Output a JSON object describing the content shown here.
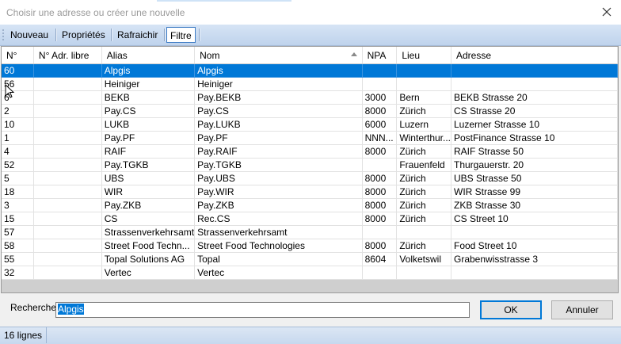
{
  "window": {
    "title": "Choisir une adresse ou créer une nouvelle"
  },
  "toolbar": {
    "items": [
      "Nouveau",
      "Propriétés",
      "Rafraichir",
      "Filtre"
    ]
  },
  "grid": {
    "columns": [
      "N°",
      "N° Adr. libre",
      "Alias",
      "Nom",
      "NPA",
      "Lieu",
      "Adresse"
    ],
    "sort_column": "Nom",
    "rows": [
      [
        "60",
        "",
        "Alpgis",
        "Alpgis",
        "",
        "",
        ""
      ],
      [
        "56",
        "",
        "Heiniger",
        "Heiniger",
        "",
        "",
        ""
      ],
      [
        "6",
        "",
        "BEKB",
        "Pay.BEKB",
        "3000",
        "Bern",
        "BEKB Strasse 20"
      ],
      [
        "2",
        "",
        "Pay.CS",
        "Pay.CS",
        "8000",
        "Zürich",
        "CS Strasse 20"
      ],
      [
        "10",
        "",
        "LUKB",
        "Pay.LUKB",
        "6000",
        "Luzern",
        "Luzerner Strasse 10"
      ],
      [
        "1",
        "",
        "Pay.PF",
        "Pay.PF",
        "NNN...",
        "Winterthur...",
        "PostFinance Strasse 10"
      ],
      [
        "4",
        "",
        "RAIF",
        "Pay.RAIF",
        "8000",
        "Zürich",
        "RAIF Strasse 50"
      ],
      [
        "52",
        "",
        "Pay.TGKB",
        "Pay.TGKB",
        "",
        "Frauenfeld",
        "Thurgauerstr. 20"
      ],
      [
        "5",
        "",
        "UBS",
        "Pay.UBS",
        "8000",
        "Zürich",
        "UBS Strasse 50"
      ],
      [
        "18",
        "",
        "WIR",
        "Pay.WIR",
        "8000",
        "Zürich",
        "WIR Strasse 99"
      ],
      [
        "3",
        "",
        "Pay.ZKB",
        "Pay.ZKB",
        "8000",
        "Zürich",
        "ZKB Strasse 30"
      ],
      [
        "15",
        "",
        "CS",
        "Rec.CS",
        "8000",
        "Zürich",
        "CS Street 10"
      ],
      [
        "57",
        "",
        "Strassenverkehrsamt",
        "Strassenverkehrsamt",
        "",
        "",
        ""
      ],
      [
        "58",
        "",
        "Street Food Techn...",
        "Street Food Technologies",
        "8000",
        "Zürich",
        "Food Street 10"
      ],
      [
        "55",
        "",
        "Topal Solutions AG",
        "Topal",
        "8604",
        "Volketswil",
        "Grabenwisstrasse 3"
      ],
      [
        "32",
        "",
        "Vertec",
        "Vertec",
        "",
        "",
        ""
      ]
    ],
    "selected_row": 0
  },
  "search": {
    "label": "Recherche",
    "value": "Alpgis"
  },
  "buttons": {
    "ok": "OK",
    "cancel": "Annuler"
  },
  "status": {
    "count": "16 lignes"
  },
  "colors": {
    "selection": "#0078d7",
    "toolbar": "#c9daf0"
  }
}
